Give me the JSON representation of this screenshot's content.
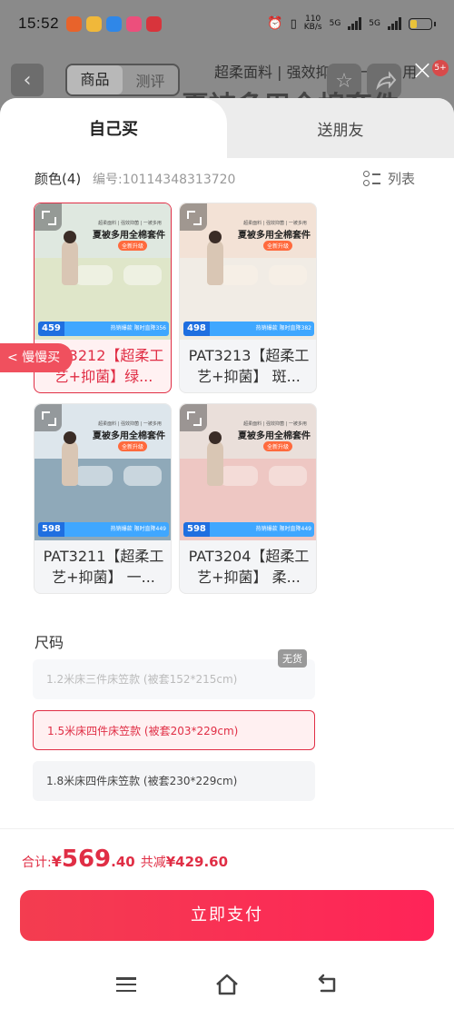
{
  "status_bar": {
    "time": "15:52",
    "network_speed": "110\nKB/s",
    "sim1": "5G",
    "sim2": "5G"
  },
  "background_page": {
    "back_label": "<",
    "tabs": [
      "商品",
      "测评"
    ],
    "slogan": "超柔面料 | 强效抑菌 | 一被多用",
    "title": "夏被多用全棉套件",
    "cart_badge": "5+"
  },
  "sheet": {
    "tabs": [
      "自己买",
      "送朋友"
    ],
    "close_label": "×",
    "color_section": {
      "title": "颜色(4)",
      "code_label": "编号:",
      "code": "10114348313720",
      "list_toggle": "列表"
    },
    "products": [
      {
        "name": "PAT3212【超柔工艺+抑菌】绿...",
        "banner_small": "超柔面料 | 强效抑菌 | 一被多用",
        "banner_title": "夏被多用全棉套件",
        "tag": "全新升级",
        "price": "459",
        "promo": "热销爆款 限时直降356",
        "selected": true,
        "palette": {
          "sky": "#dfe8e0",
          "bed": "#dfe6c9",
          "pillow": "#eef1e2"
        }
      },
      {
        "name": "PAT3213【超柔工艺+抑菌】 斑...",
        "banner_small": "超柔面料 | 强效抑菌 | 一被多用",
        "banner_title": "夏被多用全棉套件",
        "tag": "全新升级",
        "price": "498",
        "promo": "热销爆款 限时直降382",
        "selected": false,
        "palette": {
          "sky": "#f3e2d6",
          "bed": "#f1ece5",
          "pillow": "#f6efe6"
        }
      },
      {
        "name": "PAT3211【超柔工艺+抑菌】 一...",
        "banner_small": "超柔面料 | 强效抑菌 | 一被多用",
        "banner_title": "夏被多用全棉套件",
        "tag": "全新升级",
        "price": "598",
        "promo": "热销爆款 限时直降449",
        "selected": false,
        "palette": {
          "sky": "#dde6ec",
          "bed": "#8fa9b9",
          "pillow": "#c9d6de"
        }
      },
      {
        "name": "PAT3204【超柔工艺+抑菌】 柔...",
        "banner_small": "超柔面料 | 强效抑菌 | 一被多用",
        "banner_title": "夏被多用全棉套件",
        "tag": "全新升级",
        "price": "598",
        "promo": "热销爆款 限时直降449",
        "selected": false,
        "palette": {
          "sky": "#eadfda",
          "bed": "#eec7c3",
          "pillow": "#f4dcd8"
        }
      }
    ],
    "float_tag": "< 慢慢买",
    "size_section": {
      "title": "尺码",
      "options": [
        {
          "label": "1.2米床三件床笠款 (被套152*215cm)",
          "state": "disabled"
        },
        {
          "label": "1.5米床四件床笠款 (被套203*229cm)",
          "state": "selected"
        },
        {
          "label": "1.8米床四件床笠款 (被套230*229cm)",
          "state": "normal"
        }
      ],
      "no_stock_label": "无货"
    },
    "total": {
      "label": "合计:",
      "currency": "¥",
      "integer": "569",
      "decimal": ".40",
      "save_label": "共减",
      "save_value": "¥429.60"
    },
    "pay_button": "立即支付"
  },
  "colors": {
    "accent": "#e02e45",
    "pay_button": "#ff2458"
  },
  "icons": [
    "back-chevron-icon",
    "star-icon",
    "share-icon",
    "close-icon",
    "list-view-icon",
    "expand-icon",
    "menu-icon",
    "home-icon",
    "back-icon"
  ]
}
